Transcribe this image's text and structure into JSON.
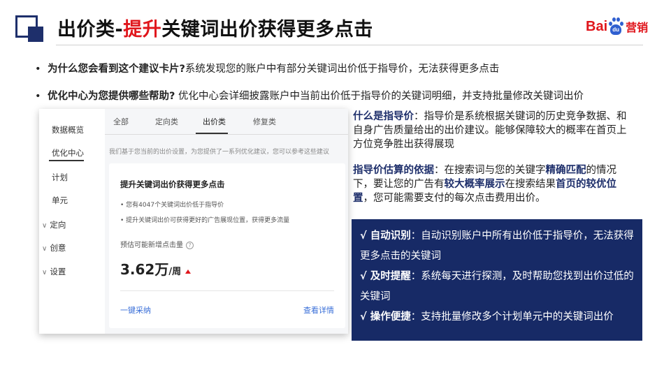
{
  "header": {
    "title_prefix": "出价类-",
    "title_highlight": "提升",
    "title_suffix": "关键词出价获得更多点击",
    "logo_bai": "Bai",
    "logo_du": "du",
    "logo_yingxiao": "营销"
  },
  "bullets": [
    {
      "dot": "•",
      "question": "为什么您会看到这个建议卡片?",
      "answer": "系统发现您的账户中有部分关键词出价低于指导价，无法获得更多点击"
    },
    {
      "dot": "•",
      "question": "优化中心为您提供哪些帮助?",
      "answer": " 优化中心会详细披露账户中当前出价低于指导价的关键词明细，并支持批量修改关键词出价"
    }
  ],
  "screenshot": {
    "sidebar": [
      {
        "label": "数据概览",
        "chevron": ""
      },
      {
        "label": "优化中心",
        "chevron": ""
      },
      {
        "label": "计划",
        "chevron": ""
      },
      {
        "label": "单元",
        "chevron": ""
      },
      {
        "label": "定向",
        "chevron": "∨"
      },
      {
        "label": "创意",
        "chevron": "∨"
      },
      {
        "label": "设置",
        "chevron": "∨"
      }
    ],
    "tabs": [
      "全部",
      "定向类",
      "出价类",
      "修复类"
    ],
    "notice": "我们基于您当前的出价设置，为您提供了一系列优化建议，您可以参考这些建议",
    "card": {
      "title": "提升关键词出价获得更多点击",
      "items": [
        "• 您有4047个关键词出价低于指导价",
        "• 提升关键词出价可获得更好的广告展现位置，获得更多流量"
      ],
      "estimate_label": "预估可能新增点击量",
      "help": "?",
      "value": "3.62万",
      "unit": "/周",
      "link_left": "一键采纳",
      "link_right": "查看详情"
    }
  },
  "right": {
    "p1_label": "什么是指导价",
    "p1_text": "：指导价是系统根据关键词的历史竞争数据、和自身广告质量给出的出价建议。能够保障较大的概率在首页上方位竞争胜出获得展现",
    "p2_label": "指导价估算的依据",
    "p2_a": "：在搜索词与您的关键字",
    "p2_b": "精确匹配",
    "p2_c": "的情况下，要让您的广告有",
    "p2_d": "较大概率展示",
    "p2_e": "在搜索结果",
    "p2_f": "首页的较优位置",
    "p2_g": "，您可能需要支付的每次点击费用出价。"
  },
  "features": [
    {
      "label": "√ 自动识别",
      "text": "：自动识别账户中所有出价低于指导价，无法获得更多点击的关键词"
    },
    {
      "label": "√ 及时提醒",
      "text": "：系统每天进行探测，及时帮助您找到出价过低的关键词"
    },
    {
      "label": "√ 操作便捷",
      "text": "：支持批量修改多个计划单元中的关键词出价"
    }
  ]
}
